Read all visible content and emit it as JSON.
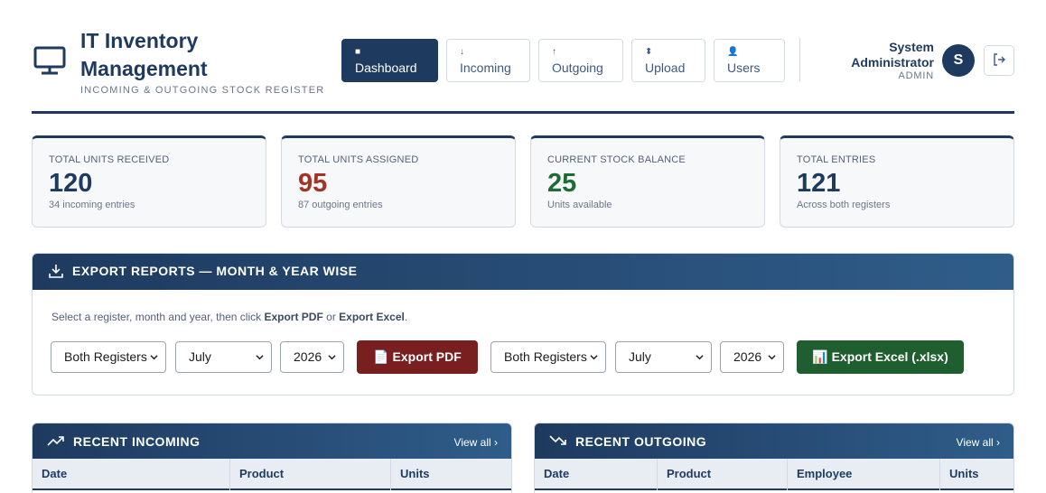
{
  "brand": {
    "title": "IT Inventory Management",
    "subtitle": "INCOMING & OUTGOING STOCK REGISTER",
    "icon": "monitor-icon"
  },
  "nav": [
    {
      "label": "Dashboard",
      "icon": "■",
      "active": true
    },
    {
      "label": "Incoming",
      "icon": "↓",
      "active": false
    },
    {
      "label": "Outgoing",
      "icon": "↑",
      "active": false
    },
    {
      "label": "Upload",
      "icon": "⬍",
      "active": false
    },
    {
      "label": "Users",
      "icon": "👤",
      "active": false
    }
  ],
  "user": {
    "name": "System Administrator",
    "role": "ADMIN",
    "initial": "S"
  },
  "stats": [
    {
      "label": "TOTAL UNITS RECEIVED",
      "value": "120",
      "note": "34 incoming entries",
      "color": "#1e3a5f"
    },
    {
      "label": "TOTAL UNITS ASSIGNED",
      "value": "95",
      "note": "87 outgoing entries",
      "color": "#a33327"
    },
    {
      "label": "CURRENT STOCK BALANCE",
      "value": "25",
      "note": "Units available",
      "color": "#1f6b35"
    },
    {
      "label": "TOTAL ENTRIES",
      "value": "121",
      "note": "Across both registers",
      "color": "#1e3a5f"
    }
  ],
  "export": {
    "title": "EXPORT REPORTS — MONTH & YEAR WISE",
    "desc_prefix": "Select a register, month and year, then click ",
    "desc_pdf": "Export PDF",
    "desc_mid": " or ",
    "desc_excel": "Export Excel",
    "desc_suffix": ".",
    "pdf": {
      "register": "Both Registers",
      "month": "July",
      "year": "2026",
      "button": "📄 Export PDF"
    },
    "excel": {
      "register": "Both Registers",
      "month": "July",
      "year": "2026",
      "button": "📊 Export Excel (.xlsx)"
    }
  },
  "recent_incoming": {
    "title": "RECENT INCOMING",
    "view_all": "View all ›",
    "columns": [
      "Date",
      "Product",
      "Units"
    ]
  },
  "recent_outgoing": {
    "title": "RECENT OUTGOING",
    "view_all": "View all ›",
    "columns": [
      "Date",
      "Product",
      "Employee",
      "Units"
    ]
  },
  "colors": {
    "primary": "#1e3a5f",
    "pdf": "#7a1f1f",
    "excel": "#1f5f2f"
  }
}
